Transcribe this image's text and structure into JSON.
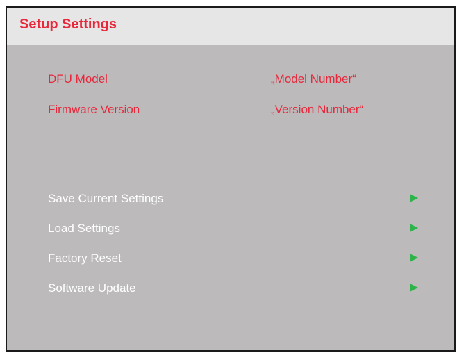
{
  "header": {
    "title": "Setup Settings"
  },
  "info": [
    {
      "label": "DFU Model",
      "value": "„Model Number“"
    },
    {
      "label": "Firmware Version",
      "value": "„Version Number“"
    }
  ],
  "menu": [
    {
      "label": "Save Current Settings",
      "icon": "play-arrow-icon"
    },
    {
      "label": "Load Settings",
      "icon": "play-arrow-icon"
    },
    {
      "label": "Factory Reset",
      "icon": "play-arrow-icon"
    },
    {
      "label": "Software Update",
      "icon": "play-arrow-icon"
    }
  ],
  "colors": {
    "accent": "#e8273b",
    "arrow": "#2db34a",
    "panel_background": "#bcbabb",
    "header_background": "#e6e6e6",
    "menu_text": "#ffffff"
  }
}
